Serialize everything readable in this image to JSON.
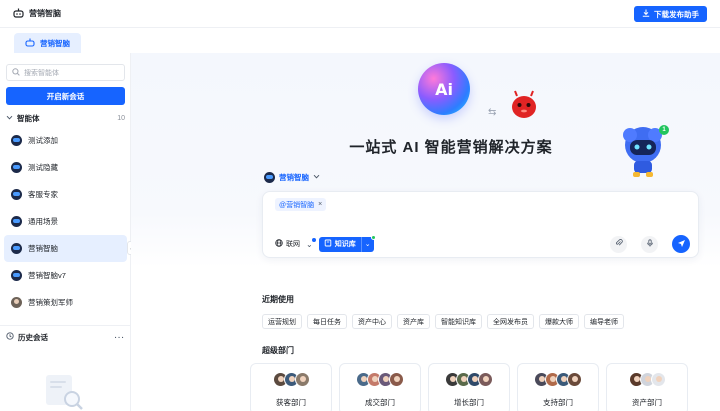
{
  "app": {
    "title": "营销智脑",
    "download_label": "下载发布助手"
  },
  "tabs": [
    {
      "label": "营销智脑"
    }
  ],
  "sidebar": {
    "search_placeholder": "搜索智能体",
    "new_chat_label": "开启新会话",
    "agents_title": "智能体",
    "agents_count": "10",
    "agents": [
      {
        "label": "测试添加",
        "avatar": "robot"
      },
      {
        "label": "测试隐藏",
        "avatar": "robot"
      },
      {
        "label": "客服专家",
        "avatar": "robot"
      },
      {
        "label": "通用场景",
        "avatar": "robot"
      },
      {
        "label": "营销智脑",
        "avatar": "robot",
        "active": true
      },
      {
        "label": "营销智脑v7",
        "avatar": "robot"
      },
      {
        "label": "营销策划军师",
        "avatar": "person"
      }
    ],
    "history_title": "历史会话",
    "history_more": "···"
  },
  "hero": {
    "logo_text": "Ai",
    "title": "一站式 AI 智能营销解决方案",
    "badge_count": "1"
  },
  "composer": {
    "agent_name": "营销智脑",
    "mention_chip": "@营销智脑",
    "network_label": "联网",
    "kb_label": "知识库"
  },
  "recent": {
    "title": "近期使用",
    "tags": [
      "运营规划",
      "每日任务",
      "资产中心",
      "资产库",
      "智能知识库",
      "全网发布员",
      "爆款大师",
      "编导老师"
    ]
  },
  "departments": {
    "title": "超级部门",
    "items": [
      {
        "name": "获客部门"
      },
      {
        "name": "成交部门"
      },
      {
        "name": "增长部门"
      },
      {
        "name": "支持部门"
      },
      {
        "name": "资产部门"
      }
    ]
  },
  "colors": {
    "accent": "#1664ff",
    "active_bg": "#e6efff",
    "green": "#22c55e"
  }
}
